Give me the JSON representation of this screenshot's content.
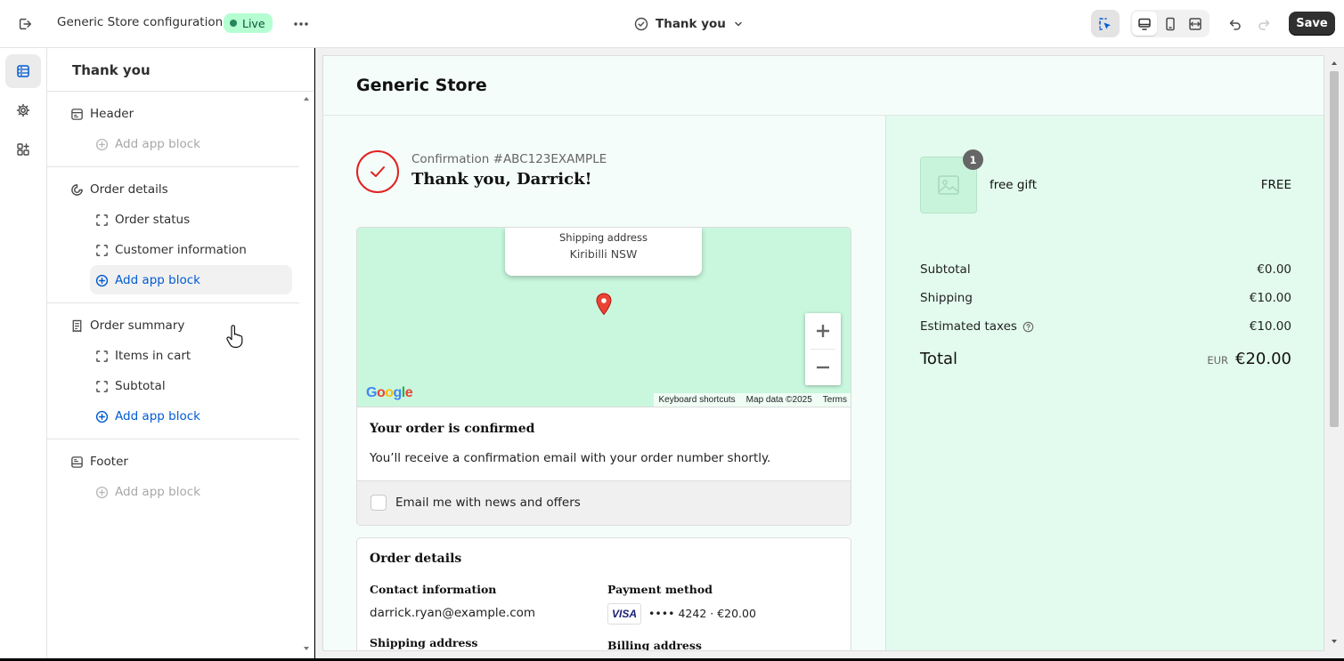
{
  "topbar": {
    "title": "Generic Store configuration",
    "status_badge": "Live",
    "page_selector": "Thank you",
    "save_label": "Save"
  },
  "sidebar": {
    "title": "Thank you",
    "sections": [
      {
        "label": "Header",
        "items": [],
        "add_label": "Add app block",
        "add_enabled": false
      },
      {
        "label": "Order details",
        "items": [
          "Order status",
          "Customer information"
        ],
        "add_label": "Add app block",
        "add_enabled": true
      },
      {
        "label": "Order summary",
        "items": [
          "Items in cart",
          "Subtotal"
        ],
        "add_label": "Add app block",
        "add_enabled": true
      },
      {
        "label": "Footer",
        "items": [],
        "add_label": "Add app block",
        "add_enabled": false
      }
    ]
  },
  "preview": {
    "store_name": "Generic Store",
    "confirmation_number": "Confirmation #ABC123EXAMPLE",
    "thanks_heading": "Thank you, Darrick!",
    "map": {
      "tooltip_label": "Shipping address",
      "tooltip_value": "Kiribilli NSW",
      "google_logo": "Google",
      "footer": [
        "Keyboard shortcuts",
        "Map data ©2025",
        "Terms"
      ]
    },
    "order_confirmed_title": "Your order is confirmed",
    "order_confirmed_text": "You’ll receive a confirmation email with your order number shortly.",
    "email_opt_in": "Email me with news and offers",
    "order_details": {
      "title": "Order details",
      "contact_heading": "Contact information",
      "contact_value": "darrick.ryan@example.com",
      "payment_heading": "Payment method",
      "card_brand": "VISA",
      "payment_value": "•••• 4242 · €20.00",
      "shipping_heading": "Shipping address",
      "billing_heading": "Billing address"
    },
    "summary": {
      "item": {
        "quantity": "1",
        "name": "free gift",
        "price": "FREE"
      },
      "subtotal_label": "Subtotal",
      "subtotal_value": "€0.00",
      "shipping_label": "Shipping",
      "shipping_value": "€10.00",
      "taxes_label": "Estimated taxes",
      "taxes_value": "€10.00",
      "total_label": "Total",
      "total_currency": "EUR",
      "total_value": "€20.00"
    }
  },
  "colors": {
    "accent": "#005bd3",
    "live_badge_bg": "#b4fed2",
    "check_red": "#e22120",
    "summary_bg": "#e3fbef",
    "map_bg": "#c8f7dd"
  }
}
